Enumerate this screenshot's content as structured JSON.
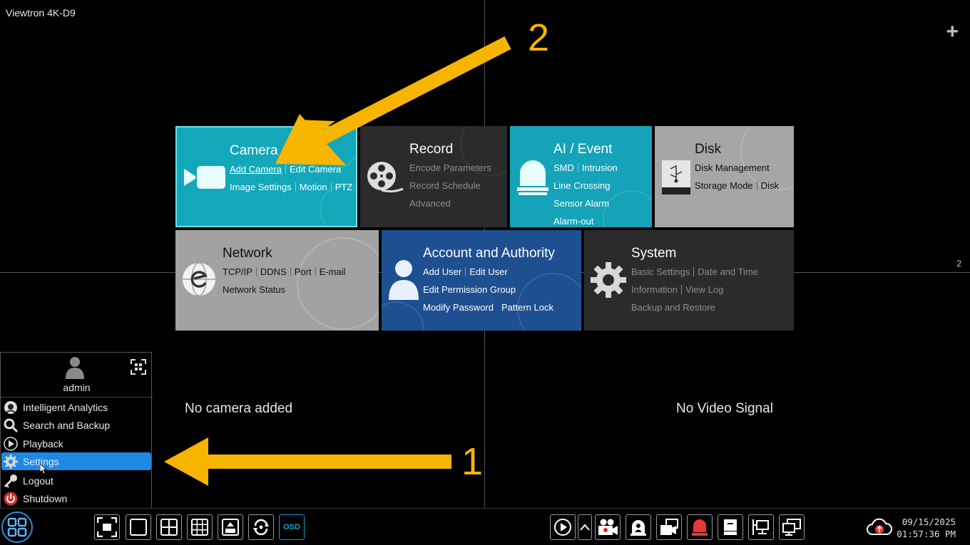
{
  "device_title": "Viewtron 4K-D9",
  "plus_label": "+",
  "channel_number": "2",
  "view": {
    "left_status": "No camera added",
    "right_status": "No Video Signal"
  },
  "tiles": {
    "camera": {
      "title": "Camera",
      "links": [
        "Add Camera",
        "Edit Camera",
        "Image Settings",
        "Motion",
        "PTZ"
      ],
      "color": "#13a7ba"
    },
    "record": {
      "title": "Record",
      "links": [
        "Encode Parameters",
        "Record Schedule",
        "Advanced"
      ],
      "color": "#2b2b2b"
    },
    "ai_event": {
      "title": "AI / Event",
      "links": [
        "SMD",
        "Intrusion",
        "Line Crossing",
        "Sensor Alarm",
        "Alarm-out"
      ],
      "color": "#14a3b8"
    },
    "disk": {
      "title": "Disk",
      "links": [
        "Disk Management",
        "Storage Mode",
        "Disk"
      ],
      "color": "#a6a6a6"
    },
    "network": {
      "title": "Network",
      "links": [
        "TCP/IP",
        "DDNS",
        "Port",
        "E-mail",
        "Network Status"
      ],
      "color": "#a2a2a2"
    },
    "account": {
      "title": "Account and Authority",
      "links": [
        "Add User",
        "Edit User",
        "Edit Permission Group",
        "Modify Password",
        "Pattern Lock"
      ],
      "color": "#1e4f90"
    },
    "system": {
      "title": "System",
      "links": [
        "Basic Settings",
        "Date and Time",
        "Information",
        "View Log",
        "Backup and Restore"
      ],
      "color": "#2b2b2b"
    }
  },
  "menu": {
    "username": "admin",
    "items": [
      {
        "label": "Intelligent Analytics",
        "icon": "analytics-icon"
      },
      {
        "label": "Search and Backup",
        "icon": "search-icon"
      },
      {
        "label": "Playback",
        "icon": "play-icon"
      },
      {
        "label": "Settings",
        "icon": "gear-icon",
        "active": true
      },
      {
        "label": "Logout",
        "icon": "key-icon"
      },
      {
        "label": "Shutdown",
        "icon": "power-icon"
      }
    ]
  },
  "annotations": {
    "arrow1_number": "1",
    "arrow2_number": "2",
    "color": "#f7b500"
  },
  "toolbar": {
    "osd_label": "OSD",
    "left_buttons": [
      "fullscreen-icon",
      "layout-1-icon",
      "layout-4-icon",
      "layout-9-icon",
      "layout-pip-icon",
      "sequence-icon"
    ],
    "right_buttons": [
      "playback-icon",
      "expand-up-icon",
      "camera-record-icon",
      "alarm-person-icon",
      "multi-camera-icon",
      "alarm-light-icon",
      "disk-status-icon",
      "network-status-icon",
      "monitor-icon"
    ]
  },
  "clock": {
    "date": "09/15/2025",
    "time": "01:57:36 PM"
  }
}
